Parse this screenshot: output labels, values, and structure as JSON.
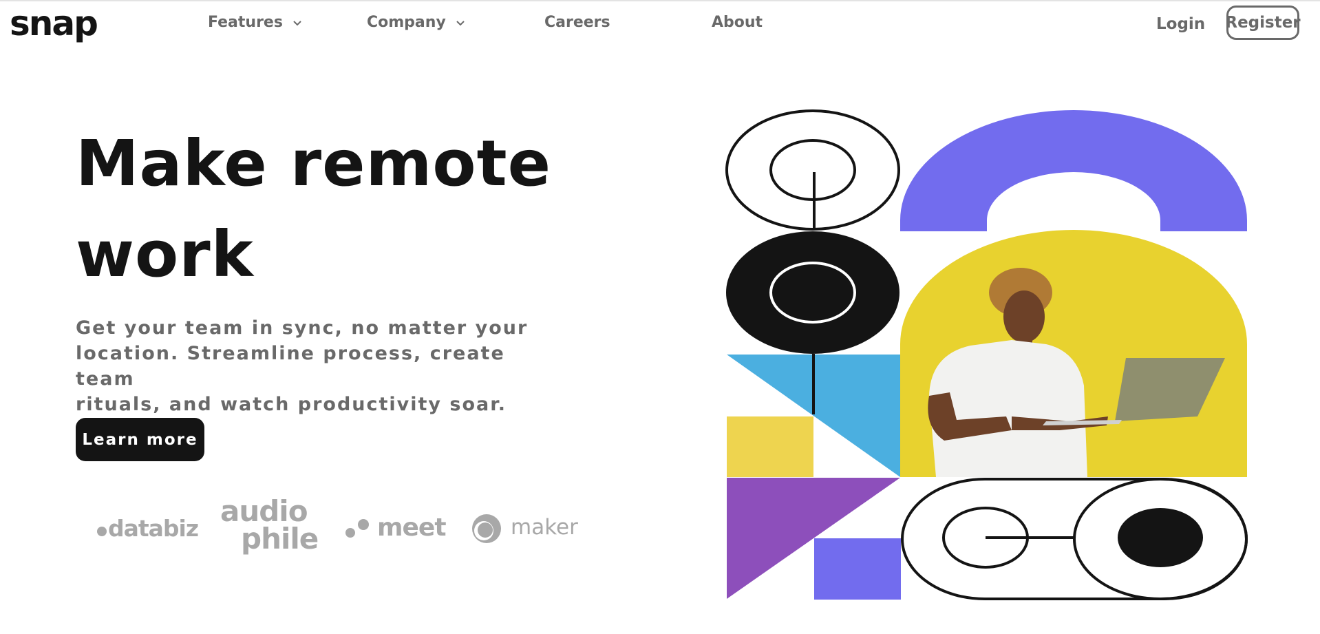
{
  "brand": {
    "logo": "snap"
  },
  "nav": {
    "items": [
      {
        "label": "Features",
        "has_dropdown": true
      },
      {
        "label": "Company",
        "has_dropdown": true
      },
      {
        "label": "Careers",
        "has_dropdown": false
      },
      {
        "label": "About",
        "has_dropdown": false
      }
    ],
    "login": "Login",
    "register": "Register"
  },
  "hero": {
    "title_line1": "Make remote",
    "title_line2": "work",
    "subtitle_line1": "Get your team in sync, no matter your",
    "subtitle_line2": "location. Streamline process, create team",
    "subtitle_line3": "rituals, and watch productivity soar.",
    "cta": "Learn more"
  },
  "clients": {
    "databiz": "databiz",
    "audiophile_top": "audio",
    "audiophile_bottom": "phile",
    "meet": "meet",
    "maker": "maker"
  },
  "colors": {
    "text_dark": "#141414",
    "text_gray": "#696969",
    "logo_gray": "#a8a8a8",
    "purple": "#726cee",
    "yellow": "#e8d22f",
    "blue": "#4bafe0",
    "violet": "#8d4fbb",
    "mustard": "#eed44f"
  },
  "icons": {
    "dropdown": "chevron-down-icon",
    "hero_image": "person-with-laptop-illustration"
  }
}
